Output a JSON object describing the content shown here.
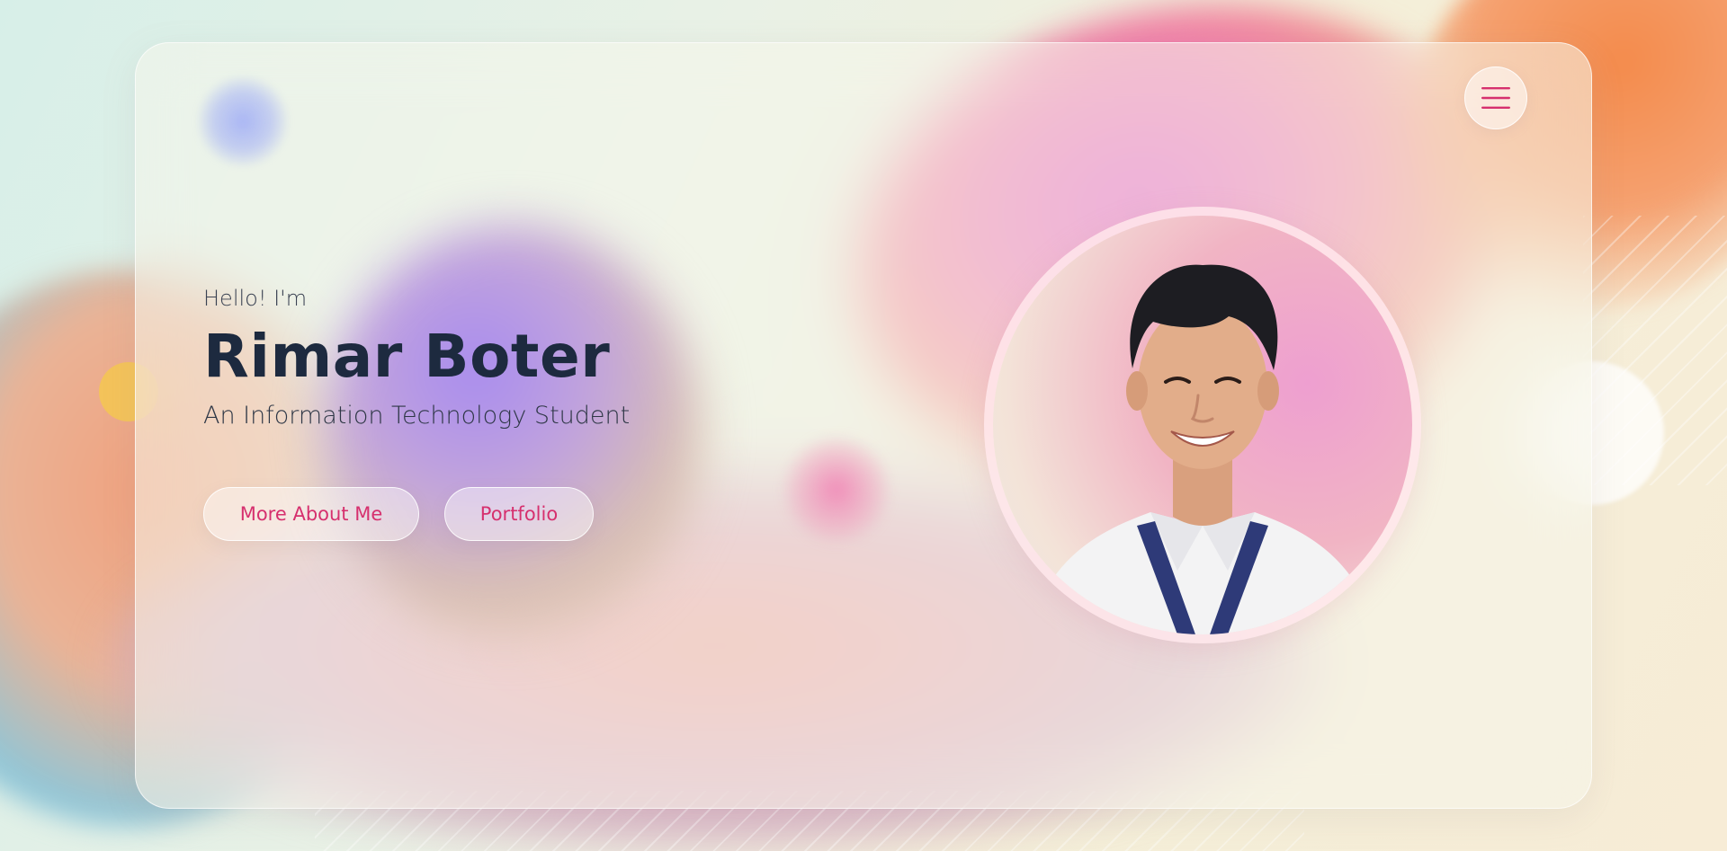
{
  "header": {
    "menu_icon": "hamburger-menu-icon"
  },
  "hero": {
    "greeting": "Hello! I'm",
    "name": "Rimar Boter",
    "subtitle": "An Information Technology Student",
    "buttons": [
      {
        "label": "More About Me"
      },
      {
        "label": "Portfolio"
      }
    ]
  },
  "portrait": {
    "alt": "Portrait of Rimar Boter"
  },
  "colors": {
    "accent": "#d6306e",
    "name_text": "#1d2a3f",
    "body_text": "#2e3746"
  }
}
